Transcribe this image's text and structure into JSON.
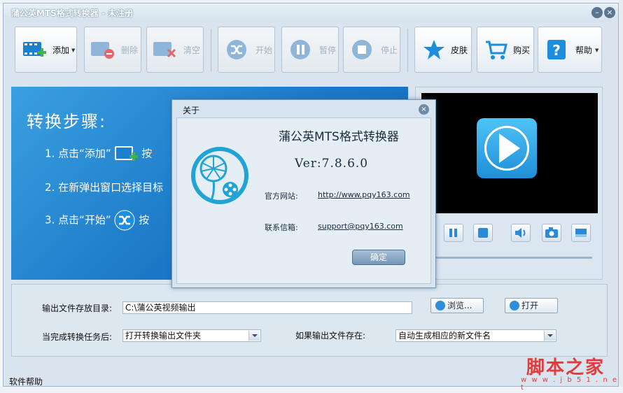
{
  "window": {
    "title": "蒲公英MTS格式转换器 - 未注册",
    "minimize": "–",
    "close": "×"
  },
  "toolbar": {
    "add": "添加",
    "delete": "删除",
    "clear": "清空",
    "start": "开始",
    "pause": "暂停",
    "stop": "停止",
    "skin": "皮肤",
    "buy": "购买",
    "help": "帮助"
  },
  "steps": {
    "title": "转换步骤:",
    "step1_prefix": "1. 点击“添加”",
    "step1_suffix": "按",
    "step2": "2. 在新弹出窗口选择目标",
    "step3_prefix": "3. 点击“开始”",
    "step3_suffix": "按"
  },
  "settings": {
    "output_dir_label": "输出文件存放目录:",
    "output_dir_value": "C:\\蒲公英视频输出",
    "browse": "浏览...",
    "open": "打开",
    "after_complete_label": "当完成转换任务后:",
    "after_complete_value": "打开转换输出文件夹",
    "if_exists_label": "如果输出文件存在:",
    "if_exists_value": "自动生成相应的新文件名"
  },
  "statusbar": {
    "help": "软件帮助"
  },
  "about": {
    "title": "关于",
    "close": "×",
    "app_name": "蒲公英MTS格式转换器",
    "version": "Ver:7.8.6.0",
    "website_label": "官方网站:",
    "website": "http://www.pqy163.com",
    "email_label": "联系信箱:",
    "email": "support@pqy163.com",
    "ok": "确定"
  },
  "watermark": {
    "text": "脚本之家",
    "url": "w w w . j b 5 1 . n e t"
  },
  "colors": {
    "accent": "#1b78c8",
    "watermark": "#e23b3b",
    "ok_button": "#7596b7"
  }
}
